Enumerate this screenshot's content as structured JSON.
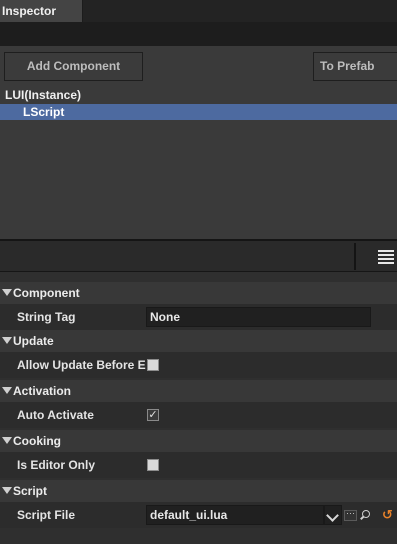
{
  "window": {
    "tab_title": "Inspector"
  },
  "toolbar": {
    "add_component_label": "Add Component",
    "to_prefab_label": "To Prefab"
  },
  "tree": {
    "root_label": "LUI(Instance)",
    "selected_child_label": "LScript"
  },
  "search": {
    "query": ""
  },
  "colors": {
    "selection": "#4d6aa0",
    "reset_accent": "#e8822a",
    "panel_bg": "#2c2c2c"
  },
  "categories": {
    "component": {
      "label": "Component",
      "string_tag": {
        "label": "String Tag",
        "value": "None"
      }
    },
    "update": {
      "label": "Update",
      "allow_update": {
        "label": "Allow Update Before E",
        "checked": false
      }
    },
    "activation": {
      "label": "Activation",
      "auto_activate": {
        "label": "Auto Activate",
        "checked": true
      }
    },
    "cooking": {
      "label": "Cooking",
      "is_editor_only": {
        "label": "Is Editor Only",
        "checked": false
      }
    },
    "script": {
      "label": "Script",
      "script_file": {
        "label": "Script File",
        "value": "default_ui.lua"
      }
    }
  },
  "icons": {
    "category_toggle": "triangle-down-icon",
    "menu": "hamburger-menu-icon",
    "combo": "chevron-down-icon",
    "browse": "ellipsis-icon",
    "find": "magnifier-icon",
    "reset": "reset-arrow-icon"
  }
}
